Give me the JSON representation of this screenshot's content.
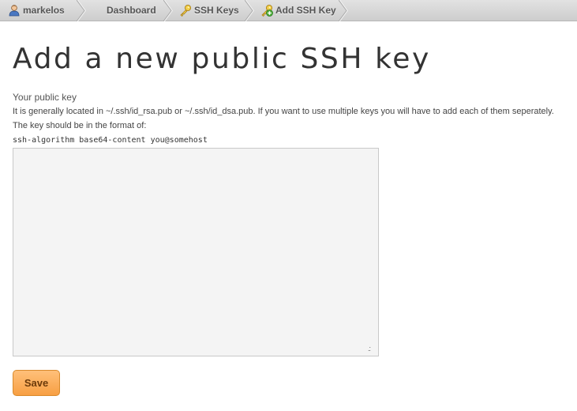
{
  "breadcrumb": {
    "items": [
      {
        "label": "markelos",
        "icon": "user-icon"
      },
      {
        "label": "Dashboard",
        "icon": ""
      },
      {
        "label": "SSH Keys",
        "icon": "key-icon"
      },
      {
        "label": "Add SSH Key",
        "icon": "key-add-icon"
      }
    ]
  },
  "page": {
    "title": "Add a new public SSH key"
  },
  "form": {
    "label": "Your public key",
    "help_location": "It is generally located in ~/.ssh/id_rsa.pub or ~/.ssh/id_dsa.pub. If you want to use multiple keys you will have to add each of them seperately.",
    "help_format": "The key should be in the format of:",
    "format_example": "ssh-algorithm base64-content you@somehost",
    "key_value": "",
    "save_label": "Save"
  },
  "colors": {
    "save_button": "#f79f43",
    "breadcrumb_bar": "#d6d6d6",
    "textarea_bg": "#f4f4f4"
  }
}
